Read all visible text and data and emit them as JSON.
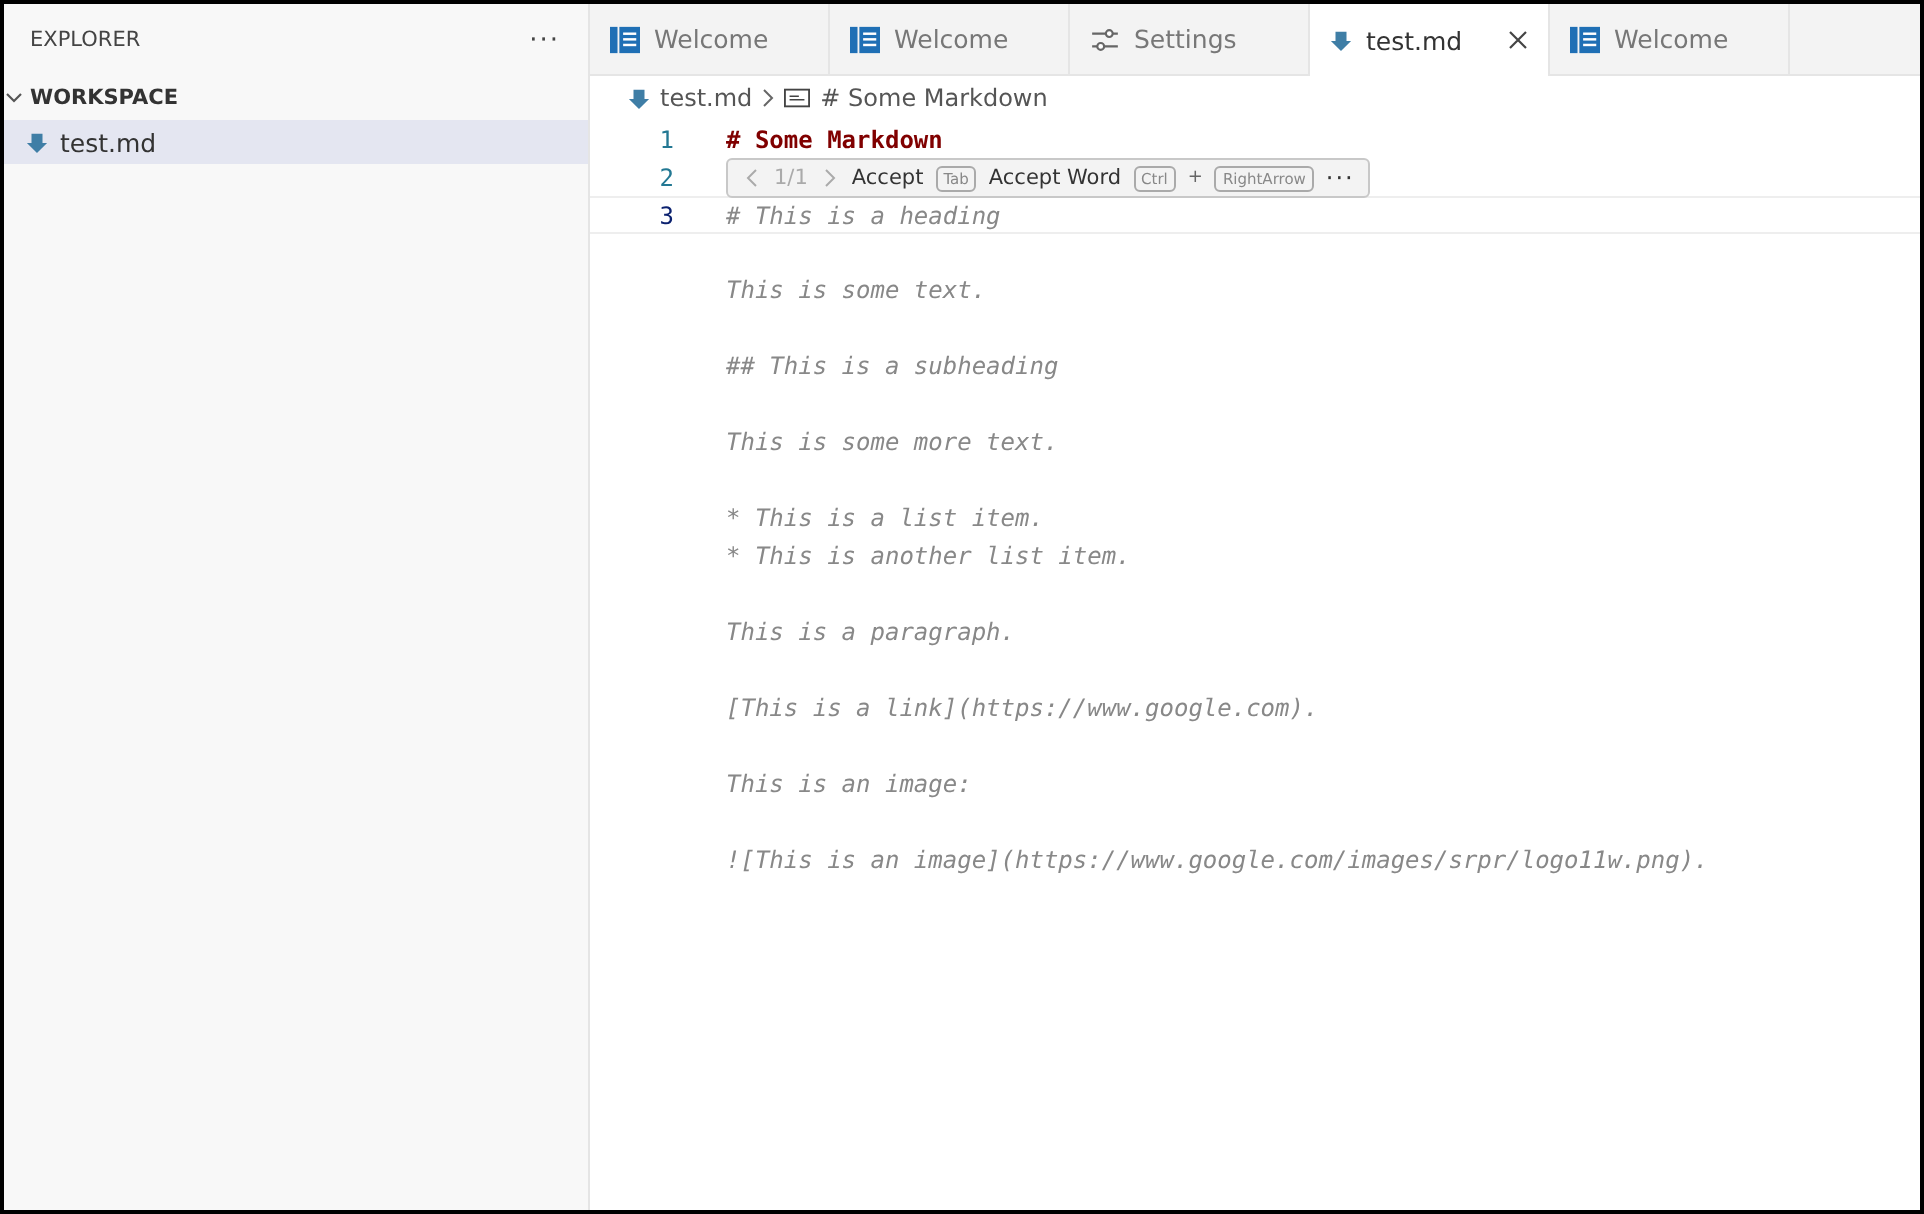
{
  "sidebar": {
    "title": "EXPLORER",
    "more": "···",
    "section": {
      "label": "WORKSPACE",
      "expanded": true
    },
    "files": [
      {
        "name": "test.md",
        "selected": true
      }
    ]
  },
  "tabs": [
    {
      "label": "Welcome",
      "kind": "welcome",
      "selected": false
    },
    {
      "label": "Welcome",
      "kind": "welcome",
      "selected": false
    },
    {
      "label": "Settings",
      "kind": "settings",
      "selected": false
    },
    {
      "label": "test.md",
      "kind": "markdown",
      "selected": true
    },
    {
      "label": "Welcome",
      "kind": "welcome",
      "selected": false
    }
  ],
  "breadcrumb": [
    {
      "label": "test.md",
      "kind": "markdown"
    },
    {
      "label": "# Some Markdown",
      "kind": "heading"
    }
  ],
  "editor": {
    "lines": [
      {
        "number": "1",
        "text": "# Some Markdown",
        "kind": "heading",
        "current": false
      },
      {
        "number": "2",
        "current": false
      },
      {
        "number": "3",
        "text": "# This is a heading",
        "kind": "ghost",
        "current": true
      }
    ],
    "ghost_blocks": [
      [
        "This is some text."
      ],
      [
        "## This is a subheading"
      ],
      [
        "This is some more text."
      ],
      [
        "* This is a list item.",
        "* This is another list item."
      ],
      [
        "This is a paragraph."
      ],
      [
        "[This is a link](https://www.google.com)."
      ],
      [
        "This is an image:"
      ],
      [
        "![This is an image](https://www.google.com/images/srpr/logo11w.png)."
      ]
    ]
  },
  "suggestion_widget": {
    "position": "1/1",
    "actions": [
      {
        "label": "Accept",
        "keys": [
          "Tab"
        ]
      },
      {
        "label": "Accept Word",
        "keys": [
          "Ctrl",
          "RightArrow"
        ],
        "joiner": "+"
      }
    ],
    "more": "···"
  }
}
